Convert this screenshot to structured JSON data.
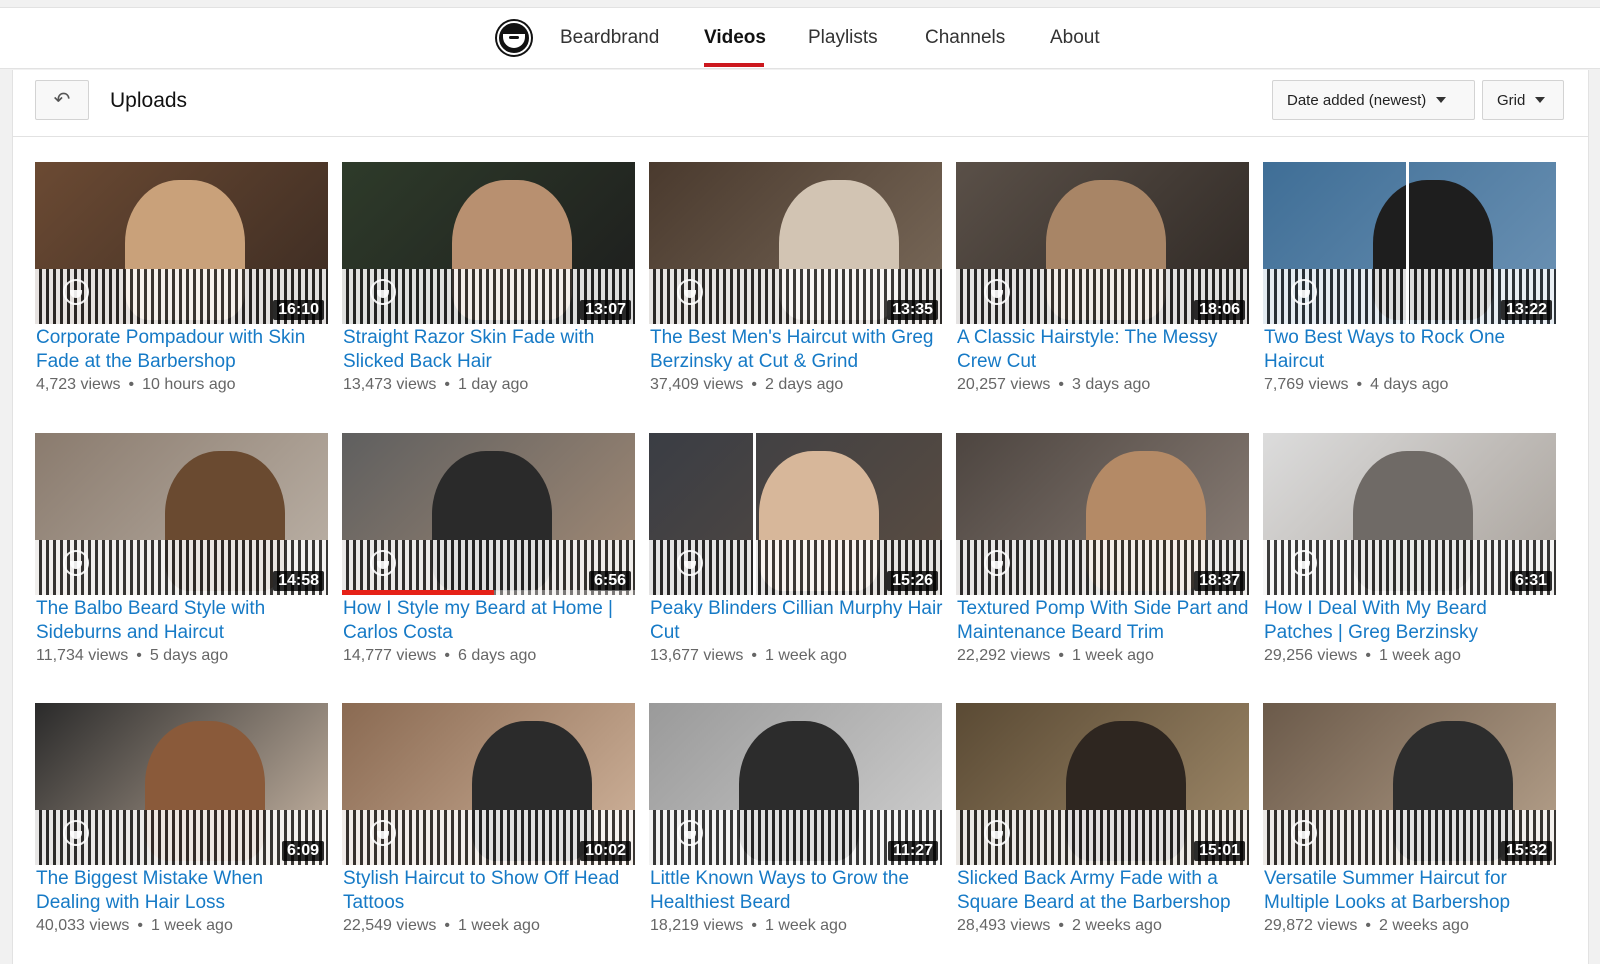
{
  "nav": {
    "channel_name": "Beardbrand",
    "tabs": [
      {
        "label": "Videos",
        "active": true
      },
      {
        "label": "Playlists",
        "active": false
      },
      {
        "label": "Channels",
        "active": false
      },
      {
        "label": "About",
        "active": false
      }
    ],
    "accent_color": "#cc181e"
  },
  "toolbar": {
    "back_icon": "back-arrow-icon",
    "title": "Uploads",
    "sort_label": "Date added (newest)",
    "view_label": "Grid"
  },
  "colors": {
    "link": "#167ac6",
    "meta": "#666666",
    "progress": "#e62117"
  },
  "videos": [
    {
      "title": "Corporate Pompadour with Skin Fade at the Barbershop",
      "views": "4,723 views",
      "age": "10 hours ago",
      "duration": "16:10"
    },
    {
      "title": "Straight Razor Skin Fade with Slicked Back Hair",
      "views": "13,473 views",
      "age": "1 day ago",
      "duration": "13:07"
    },
    {
      "title": "The Best Men's Haircut with Greg Berzinsky at Cut & Grind",
      "views": "37,409 views",
      "age": "2 days ago",
      "duration": "13:35"
    },
    {
      "title": "A Classic Hairstyle: The Messy Crew Cut",
      "views": "20,257 views",
      "age": "3 days ago",
      "duration": "18:06"
    },
    {
      "title": "Two Best Ways to Rock One Haircut",
      "views": "7,769 views",
      "age": "4 days ago",
      "duration": "13:22"
    },
    {
      "title": "The Balbo Beard Style with Sideburns and Haircut",
      "views": "11,734 views",
      "age": "5 days ago",
      "duration": "14:58"
    },
    {
      "title": "How I Style my Beard at Home | Carlos Costa",
      "views": "14,777 views",
      "age": "6 days ago",
      "duration": "6:56",
      "watched_fraction": 0.52
    },
    {
      "title": "Peaky Blinders Cillian Murphy Hair Cut",
      "views": "13,677 views",
      "age": "1 week ago",
      "duration": "15:26"
    },
    {
      "title": "Textured Pomp With Side Part and Maintenance Beard Trim",
      "views": "22,292 views",
      "age": "1 week ago",
      "duration": "18:37"
    },
    {
      "title": "How I Deal With My Beard Patches | Greg Berzinsky",
      "views": "29,256 views",
      "age": "1 week ago",
      "duration": "6:31"
    },
    {
      "title": "The Biggest Mistake When Dealing with Hair Loss",
      "views": "40,033 views",
      "age": "1 week ago",
      "duration": "6:09"
    },
    {
      "title": "Stylish Haircut to Show Off Head Tattoos",
      "views": "22,549 views",
      "age": "1 week ago",
      "duration": "10:02"
    },
    {
      "title": "Little Known Ways to Grow the Healthiest Beard",
      "views": "18,219 views",
      "age": "1 week ago",
      "duration": "11:27"
    },
    {
      "title": "Slicked Back Army Fade with a Square Beard at the Barbershop",
      "views": "28,493 views",
      "age": "2 weeks ago",
      "duration": "15:01"
    },
    {
      "title": "Versatile Summer Haircut for Multiple Looks at Barbershop",
      "views": "29,872 views",
      "age": "2 weeks ago",
      "duration": "15:32"
    }
  ]
}
